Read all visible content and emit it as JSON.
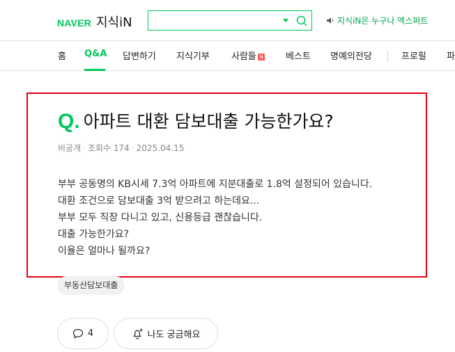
{
  "header": {
    "logo_naver": "NAVER",
    "logo_jisik": "지식iN",
    "search_value": "",
    "expert_link": "지식iN은 누구나 엑스퍼트"
  },
  "nav": {
    "items": [
      "홈",
      "Q&A",
      "답변하기",
      "지식기부",
      "사람들",
      "베스트",
      "명예의전당",
      "프로필",
      "파"
    ],
    "active": "Q&A",
    "badge": "N"
  },
  "question": {
    "mark": "Q.",
    "title": "아파트 대환 담보대출 가능한가요?",
    "author": "비공개",
    "views_label": "조회수 174",
    "date": "2025.04.15",
    "body": [
      "부부 공동명의 KB시세 7.3억 아파트에 지분대출로 1.8억 설정되어 있습니다.",
      "대환 조건으로 담보대출 3억 받으려고 하는데요...",
      "부부 모두 직장 다니고 있고, 신용등급 괜찮습니다.",
      "대출 가능한가요?",
      "이율은 얼마나 될까요?"
    ]
  },
  "tag": "부동산담보대출",
  "actions": {
    "comment_count": "4",
    "curious_label": "나도 궁금해요"
  },
  "colors": {
    "brand": "#03c75a",
    "highlight_border": "#e60012"
  }
}
